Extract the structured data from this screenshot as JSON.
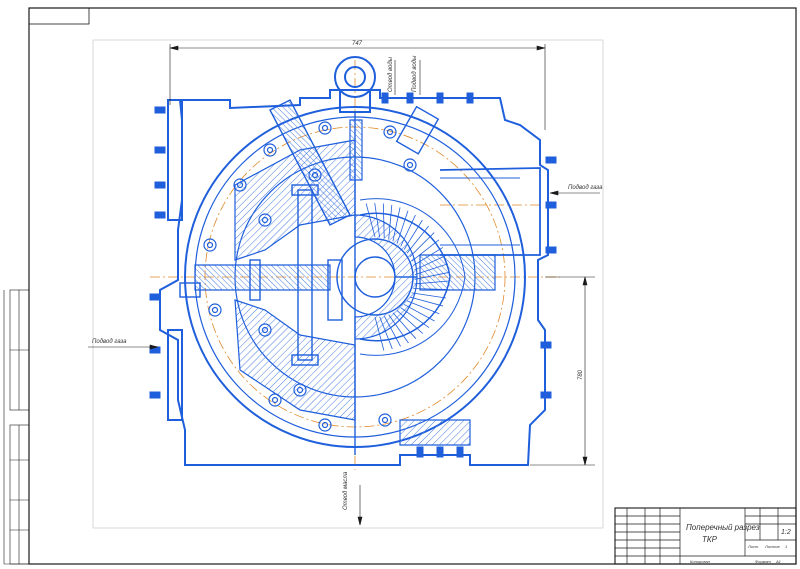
{
  "drawing": {
    "title_line1": "Поперечный разрез",
    "title_line2": "ТКР",
    "scale": "1:2",
    "sheet_word": "Лист",
    "sheets_word": "Листов",
    "sheets_count": "1",
    "copy_word": "Копировал",
    "format_word": "Формат",
    "format_value": "А1",
    "left_label": "Подвод газа",
    "right_label": "Подвод газа",
    "bottom_label": "Отвод масла",
    "top_label_1": "Подвод воды",
    "top_label_2": "Отвод воды",
    "dim_top": "747",
    "dim_right": "780"
  },
  "colors": {
    "frame": "#1a1a1a",
    "part": "#1f5fdc",
    "hatch": "#4a7ee0",
    "axis": "#e08a2a",
    "text": "#333333"
  }
}
